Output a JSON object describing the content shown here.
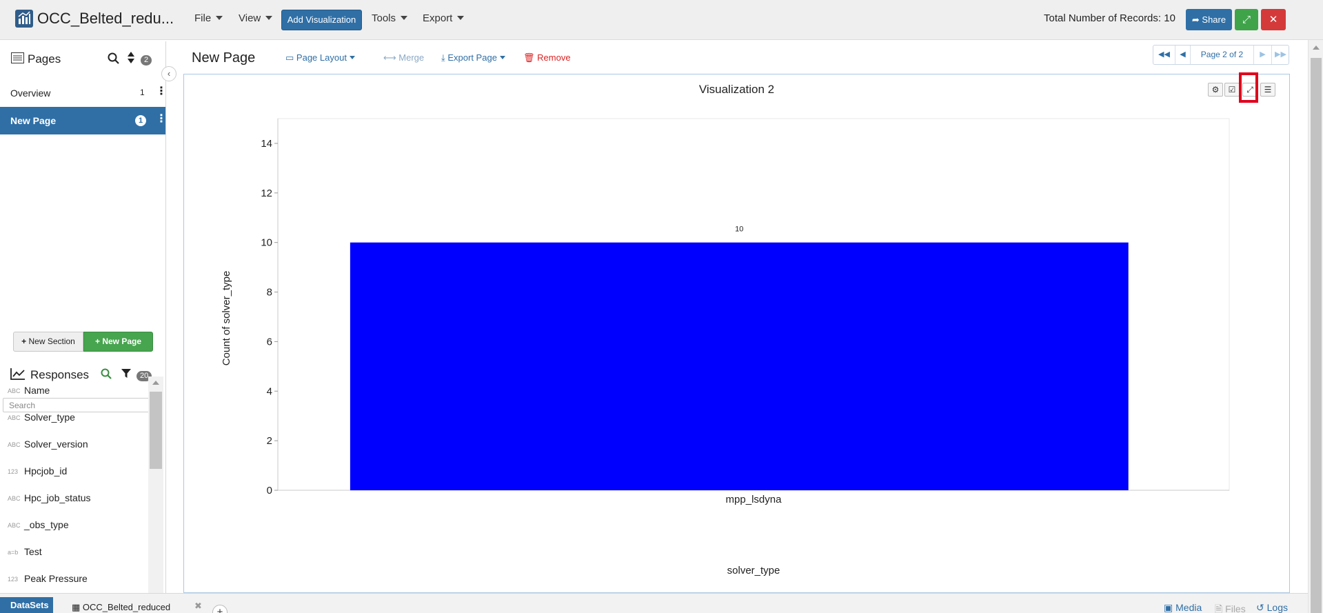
{
  "app": {
    "title": "OCC_Belted_redu...",
    "menus": [
      "File",
      "View",
      "Tools",
      "Export"
    ],
    "add_visualization": "Add Visualization",
    "records_label": "Total Number of Records: 10",
    "share_label": "Share"
  },
  "sidebar": {
    "pages_title": "Pages",
    "pages_badge": "2",
    "pages": [
      {
        "label": "Overview",
        "count": "1"
      },
      {
        "label": "New Page",
        "count": "1"
      }
    ],
    "new_section": "New Section",
    "new_page": "New Page",
    "responses_title": "Responses",
    "responses_badge": "20",
    "search_placeholder": "Search",
    "responses": [
      {
        "type": "ABC",
        "name": "Name"
      },
      {
        "type": "ABC",
        "name": "Solver_type"
      },
      {
        "type": "ABC",
        "name": "Solver_version"
      },
      {
        "type": "123",
        "name": "Hpcjob_id"
      },
      {
        "type": "ABC",
        "name": "Hpc_job_status"
      },
      {
        "type": "ABC",
        "name": "_obs_type"
      },
      {
        "type": "a=b",
        "name": "Test"
      },
      {
        "type": "123",
        "name": "Peak Pressure"
      }
    ]
  },
  "page": {
    "name": "New Page",
    "tools": {
      "page_layout": "Page Layout",
      "merge": "Merge",
      "export_page": "Export Page",
      "remove": "Remove"
    },
    "pager": "Page 2 of 2"
  },
  "visualization": {
    "title": "Visualization 2"
  },
  "chart_data": {
    "type": "bar",
    "categories": [
      "mpp_lsdyna"
    ],
    "values": [
      10
    ],
    "data_labels": [
      "10"
    ],
    "xlabel": "solver_type",
    "ylabel": "Count of solver_type",
    "ylim": [
      0,
      15
    ],
    "yticks": [
      0,
      2,
      4,
      6,
      8,
      10,
      12,
      14
    ],
    "bar_color": "#0000ff",
    "grid": false
  },
  "bottombar": {
    "datasets_tab": "DataSets",
    "file_tab": "OCC_Belted_reduced",
    "media": "Media",
    "files": "Files",
    "logs": "Logs"
  },
  "colors": {
    "primary": "#2f6fa6",
    "success": "#47a44f",
    "danger": "#d43a3a",
    "highlight": "#e0001b"
  }
}
